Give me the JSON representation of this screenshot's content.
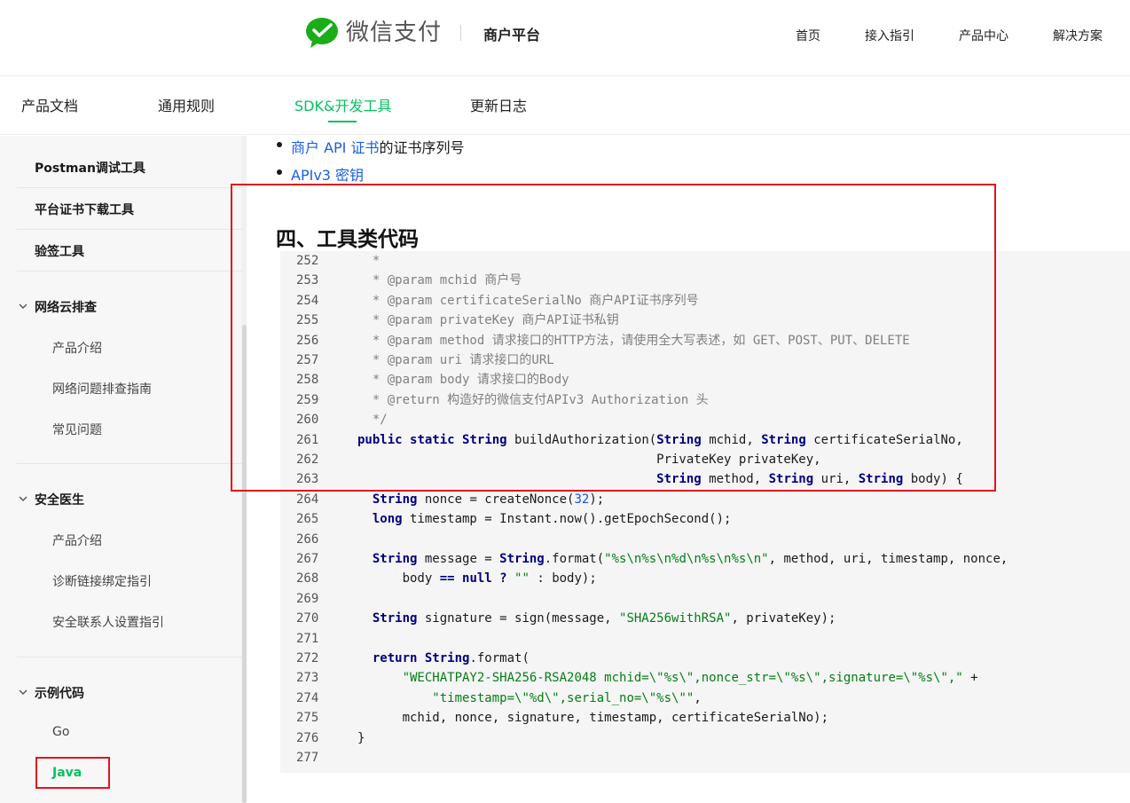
{
  "header": {
    "brand": "微信支付",
    "platform": "商户平台",
    "nav": [
      "首页",
      "接入指引",
      "产品中心",
      "解决方案"
    ]
  },
  "subnav": {
    "tabs": [
      "产品文档",
      "通用规则",
      "SDK&开发工具",
      "更新日志"
    ],
    "active_index": 2
  },
  "sidebar": {
    "tools": [
      "Postman调试工具",
      "平台证书下载工具",
      "验签工具"
    ],
    "groups": [
      {
        "title": "网络云排查",
        "items": [
          "产品介绍",
          "网络问题排查指南",
          "常见问题"
        ]
      },
      {
        "title": "安全医生",
        "items": [
          "产品介绍",
          "诊断链接绑定指引",
          "安全联系人设置指引"
        ]
      },
      {
        "title": "示例代码",
        "items": [
          "Go",
          "Java"
        ]
      }
    ],
    "active_item": "Java"
  },
  "content": {
    "bullets": [
      {
        "link": "商户 API 证书",
        "text": "的证书序列号"
      },
      {
        "link": "APIv3 密钥",
        "text": ""
      }
    ],
    "section_title": "四、工具类代码",
    "code_lines": [
      {
        "n": "252",
        "code": "  *"
      },
      {
        "n": "253",
        "code": "  * @param mchid 商户号"
      },
      {
        "n": "254",
        "code": "  * @param certificateSerialNo 商户API证书序列号"
      },
      {
        "n": "255",
        "code": "  * @param privateKey 商户API证书私钥"
      },
      {
        "n": "256",
        "code": "  * @param method 请求接口的HTTP方法，请使用全大写表述，如 GET、POST、PUT、DELETE"
      },
      {
        "n": "257",
        "code": "  * @param uri 请求接口的URL"
      },
      {
        "n": "258",
        "code": "  * @param body 请求接口的Body"
      },
      {
        "n": "259",
        "code": "  * @return 构造好的微信支付APIv3 Authorization 头"
      },
      {
        "n": "260",
        "code": "  */"
      },
      {
        "n": "261",
        "code": "public static String buildAuthorization(String mchid, String certificateSerialNo,"
      },
      {
        "n": "262",
        "code": "                                        PrivateKey privateKey,"
      },
      {
        "n": "263",
        "code": "                                        String method, String uri, String body) {"
      },
      {
        "n": "264",
        "code": "  String nonce = createNonce(32);"
      },
      {
        "n": "265",
        "code": "  long timestamp = Instant.now().getEpochSecond();"
      },
      {
        "n": "266",
        "code": ""
      },
      {
        "n": "267",
        "code": "  String message = String.format(\"%s\\n%s\\n%d\\n%s\\n%s\\n\", method, uri, timestamp, nonce,"
      },
      {
        "n": "268",
        "code": "      body == null ? \"\" : body);"
      },
      {
        "n": "269",
        "code": ""
      },
      {
        "n": "270",
        "code": "  String signature = sign(message, \"SHA256withRSA\", privateKey);"
      },
      {
        "n": "271",
        "code": ""
      },
      {
        "n": "272",
        "code": "  return String.format("
      },
      {
        "n": "273",
        "code": "      \"WECHATPAY2-SHA256-RSA2048 mchid=\\\"%s\\\",nonce_str=\\\"%s\\\",signature=\\\"%s\\\",\" +"
      },
      {
        "n": "274",
        "code": "          \"timestamp=\\\"%d\\\",serial_no=\\\"%s\\\"\","
      },
      {
        "n": "275",
        "code": "      mchid, nonce, signature, timestamp, certificateSerialNo);"
      },
      {
        "n": "276",
        "code": "}"
      },
      {
        "n": "277",
        "code": ""
      }
    ]
  },
  "colors": {
    "accent": "#07c160",
    "link": "#1a5ee6",
    "highlight": "#e0141e"
  },
  "icons": {
    "brand": "wechat-pay-logo-icon",
    "collapse": "chevron-down-icon"
  }
}
